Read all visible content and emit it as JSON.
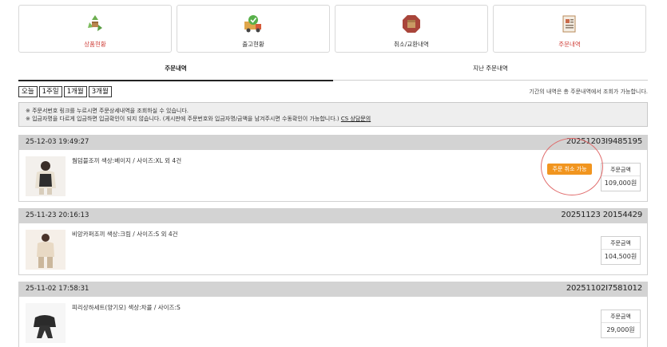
{
  "cards": [
    {
      "label": "상품현황",
      "icon": "recycle-box-icon",
      "highlight": true
    },
    {
      "label": "출고현황",
      "icon": "shipping-truck-icon",
      "highlight": false
    },
    {
      "label": "취소/교환내역",
      "icon": "cancel-box-icon",
      "highlight": false
    },
    {
      "label": "주문내역",
      "icon": "order-document-icon",
      "highlight": true
    }
  ],
  "tabs": [
    {
      "label": "주문내역",
      "active": true
    },
    {
      "label": "지난 주문내역",
      "active": false
    }
  ],
  "periods": [
    "오늘",
    "1주일",
    "1개월",
    "3개월"
  ],
  "period_note": "기간의 내역은 총 주문내역에서 조회가 가능합니다.",
  "notice": {
    "line1": "※ 주문서번호 링크를 누르시면 주문상세내역을 조회하실 수 있습니다.",
    "line2": "※ 입금자명을 다르게 입금하면 입금확인이 되지 않습니다. (게시판에 주문번호와 입금자명/금액을 남겨주시면 수동확인이 가능합니다.)",
    "link": "CS 상담문의"
  },
  "orders": [
    {
      "date": "25-12-03 19:49:27",
      "order_no": "20251203I9485195",
      "product": "웜덤블조끼 색상:베이지 / 사이즈:XL 외 4건",
      "amount_label": "주문금액",
      "amount": "109,000원",
      "cancel_label": "주문 취소 가능"
    },
    {
      "date": "25-11-23 20:16:13",
      "order_no": "20251123 20154429",
      "product": "비앙카퍼조끼 색상:크림 / 사이즈:S 외 4건",
      "amount_label": "주문금액",
      "amount": "104,500원"
    },
    {
      "date": "25-11-02 17:58:31",
      "order_no": "20251102I7581012",
      "product": "피리상하세트(양기모) 색상:차콜 / 사이즈:S",
      "amount_label": "주문금액",
      "amount": "29,000원"
    }
  ],
  "colors": {
    "accent_red": "#d0453f",
    "cancel_orange": "#f1951f",
    "header_gray": "#d3d3d3"
  }
}
